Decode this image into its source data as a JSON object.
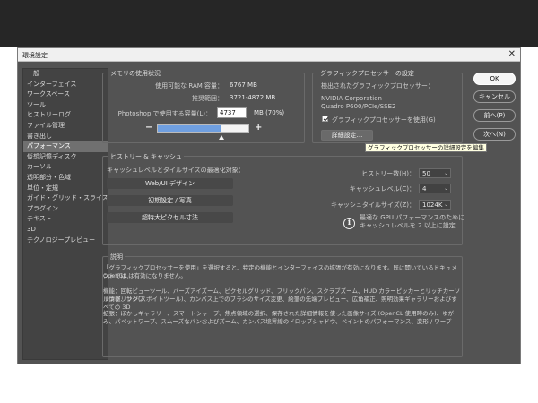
{
  "window": {
    "title": "環境設定",
    "close_glyph": "✕"
  },
  "sidebar": {
    "items": [
      "一般",
      "インターフェイス",
      "ワークスペース",
      "ツール",
      "ヒストリーログ",
      "ファイル管理",
      "書き出し",
      "パフォーマンス",
      "仮想記憶ディスク",
      "カーソル",
      "透明部分・色域",
      "単位・定規",
      "ガイド・グリッド・スライス",
      "プラグイン",
      "テキスト",
      "3D",
      "テクノロジープレビュー"
    ],
    "selected_index": 7
  },
  "memory": {
    "title": "メモリの使用状況",
    "available_label": "使用可能な RAM 容量：",
    "available_value": "6767 MB",
    "range_label": "推奨範囲：",
    "range_value": "3721-4872 MB",
    "used_label": "Photoshop で使用する容量(L)：",
    "used_value": "4737",
    "used_unit": "MB (70%)",
    "slider_fraction": 0.7,
    "minus": "−",
    "plus": "+"
  },
  "gpu": {
    "title": "グラフィックプロセッサーの設定",
    "detected_label": "検出されたグラフィックプロセッサー：",
    "vendor": "NVIDIA Corporation",
    "model": "Quadro P600/PCIe/SSE2",
    "use_label": "グラフィックプロセッサーを使用(G)",
    "use_checked": true,
    "advanced_button": "詳細設定...",
    "tooltip": "グラフィックプロセッサーの詳細設定を編集"
  },
  "history": {
    "title": "ヒストリー & キャッシュ",
    "optimize_label": "キャッシュレベルとタイルサイズの最適化対象：",
    "buttons": [
      "Web/UI デザイン",
      "初期設定 / 写真",
      "超特大ピクセル寸法"
    ],
    "states_label": "ヒストリー数(H)：",
    "states_value": "50",
    "levels_label": "キャッシュレベル(C)：",
    "levels_value": "4",
    "tile_label": "キャッシュタイルサイズ(Z)：",
    "tile_value": "1024K",
    "info_line1": "最適な GPU パフォーマンスのために",
    "info_line2": "キャッシュレベルを 2 以上に設定"
  },
  "description": {
    "title": "説明",
    "p1_line1": "「グラフィックプロセッサーを使用」を選択すると、特定の機能とインターフェイスの拡張が有効になります。既に開いているドキュメントでは、",
    "p1_line2": "OpenGL は有効になりません。",
    "p2_line1": "機能：回転ビューツール、バーズアイズーム、ピクセルグリッド、フリックパン、スクラブズーム、HUD カラーピッカーとリッチカーソル情報、サンプ",
    "p2_line2": "リングリング(スポイトツール)、カンバス上でのブラシのサイズ変更、絵筆の先端プレビュー、広角補正、照明効果ギャラリーおよびすべての 3D",
    "p3_line1": "拡張：ぼかしギャラリー、スマートシャープ、焦点領域の選択、保存された詳細情報を使った画像サイズ (OpenCL 使用時のみ)、ゆが",
    "p3_line2": "み、パペットワープ、スムーズなパンおよびズーム、カンバス境界線のドロップシャドウ、ペイントのパフォーマンス、変形 / ワープ"
  },
  "actions": {
    "ok": "OK",
    "cancel": "キャンセル",
    "prev": "前へ(P)",
    "next": "次へ(N)"
  }
}
